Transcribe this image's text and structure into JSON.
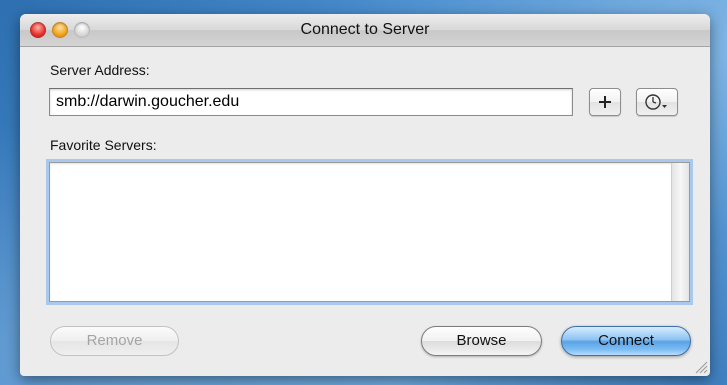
{
  "window": {
    "title": "Connect to Server"
  },
  "server_address": {
    "label": "Server Address:",
    "value": "smb://darwin.goucher.edu",
    "add_button_icon": "plus-icon",
    "recent_button_icon": "clock-icon"
  },
  "favorites": {
    "label": "Favorite Servers:",
    "items": []
  },
  "buttons": {
    "remove": "Remove",
    "browse": "Browse",
    "connect": "Connect"
  },
  "colors": {
    "default_button": "#5aa2e6",
    "focus_ring": "#a8c8ec",
    "close": "#e6322a",
    "minimize": "#f0a320"
  }
}
